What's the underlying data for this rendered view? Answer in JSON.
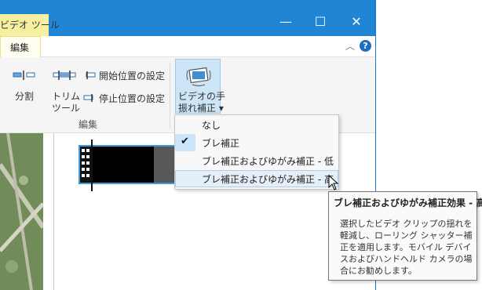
{
  "window": {
    "context_tab": "ビデオ ツール",
    "min_glyph": "—",
    "max_glyph": "☐",
    "close_glyph": "✕"
  },
  "tabs": {
    "edit": "編集",
    "collapse_glyph": "︿",
    "help_glyph": "?"
  },
  "ribbon": {
    "split": "分割",
    "trim_line1": "トリム",
    "trim_line2": "ツール",
    "set_start": "開始位置の設定",
    "set_end": "停止位置の設定",
    "hand_line1": "ビデオの手",
    "hand_line2": "振れ補正 ▾",
    "group_label": "編集"
  },
  "menu": {
    "items": [
      {
        "label": "なし"
      },
      {
        "label": "ブレ補正",
        "checked": true
      },
      {
        "label": "ブレ補正およびゆがみ補正 - 低"
      },
      {
        "label": "ブレ補正およびゆがみ補正 - 高",
        "hover": true
      }
    ],
    "check_glyph": "✔"
  },
  "tooltip": {
    "title": "ブレ補正およびゆがみ補正効果 - 高",
    "body": "選択したビデオ クリップの揺れを軽減し、ローリング シャッター補正を適用します。モバイル デバイスおよびハンドヘルド カメラの場合にお勧めします。"
  },
  "icons": {
    "split": "split-icon",
    "trim": "trim-icon",
    "set_start": "set-start-icon",
    "set_end": "set-end-icon",
    "stabilize": "video-stabilization-icon",
    "cursor": "mouse-pointer-icon"
  }
}
